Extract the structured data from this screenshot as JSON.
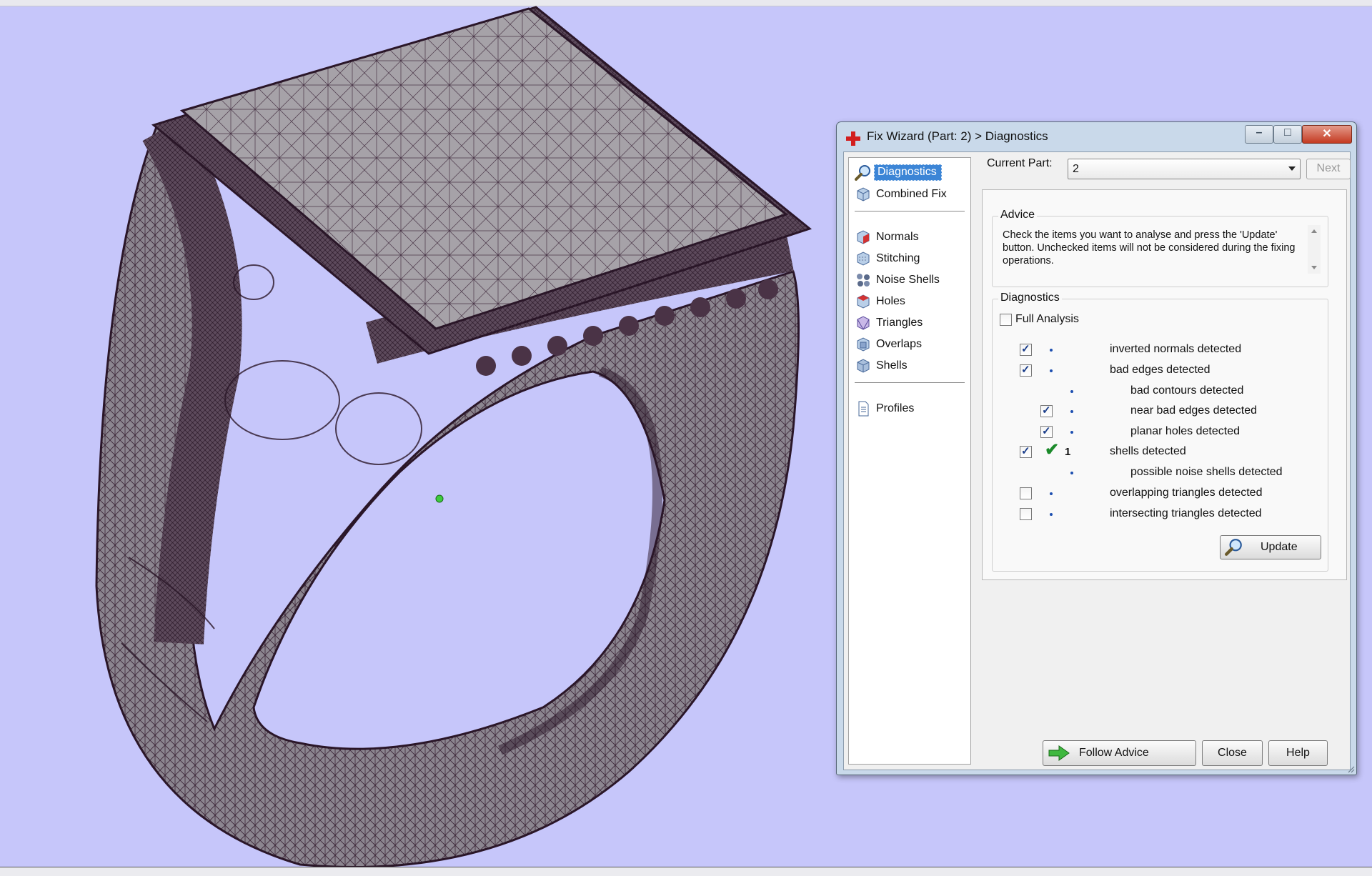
{
  "viewport": {
    "background": "#c6c6fa",
    "mesh_color": "#3a2436"
  },
  "dialog": {
    "title": "Fix Wizard (Part: 2) > Diagnostics",
    "window_controls": {
      "minimize": "–",
      "maximize": "□",
      "close": "✕"
    },
    "nav": {
      "items": [
        {
          "label": "Diagnostics",
          "icon": "magnifier-icon",
          "selected": true
        },
        {
          "label": "Combined Fix",
          "icon": "cube-icon"
        },
        {
          "label": "Normals",
          "icon": "normals-cube-icon"
        },
        {
          "label": "Stitching",
          "icon": "stitching-cube-icon"
        },
        {
          "label": "Noise Shells",
          "icon": "noise-shells-icon"
        },
        {
          "label": "Holes",
          "icon": "holes-cube-icon"
        },
        {
          "label": "Triangles",
          "icon": "triangles-cube-icon"
        },
        {
          "label": "Overlaps",
          "icon": "overlaps-cube-icon"
        },
        {
          "label": "Shells",
          "icon": "shells-cube-icon"
        },
        {
          "label": "Profiles",
          "icon": "document-icon"
        }
      ]
    },
    "current_part": {
      "label": "Current Part:",
      "value": "2",
      "next": "Next"
    },
    "advice": {
      "title": "Advice",
      "text": "Check the items you want to analyse and press the 'Update' button. Unchecked items will not be considered during the fixing operations."
    },
    "diagnostics": {
      "title": "Diagnostics",
      "full_analysis": {
        "label": "Full Analysis",
        "checked": false
      },
      "rows": [
        {
          "label": "inverted normals detected",
          "checked": true,
          "level": 0,
          "has_checkbox": true
        },
        {
          "label": "bad edges detected",
          "checked": true,
          "level": 0,
          "has_checkbox": true
        },
        {
          "label": "bad contours detected",
          "checked": false,
          "level": 1,
          "has_checkbox": false
        },
        {
          "label": "near bad edges detected",
          "checked": true,
          "level": 1,
          "has_checkbox": true
        },
        {
          "label": "planar holes detected",
          "checked": true,
          "level": 1,
          "has_checkbox": true
        },
        {
          "label": "shells detected",
          "checked": true,
          "level": 0,
          "has_checkbox": true,
          "ok": true,
          "count": "1"
        },
        {
          "label": "possible noise shells detected",
          "checked": false,
          "level": 1,
          "has_checkbox": false
        },
        {
          "label": "overlapping triangles detected",
          "checked": false,
          "level": 0,
          "has_checkbox": true
        },
        {
          "label": "intersecting triangles detected",
          "checked": false,
          "level": 0,
          "has_checkbox": true
        }
      ],
      "update_button": "Update"
    },
    "buttons": {
      "follow_advice": "Follow Advice",
      "close": "Close",
      "help": "Help"
    }
  }
}
